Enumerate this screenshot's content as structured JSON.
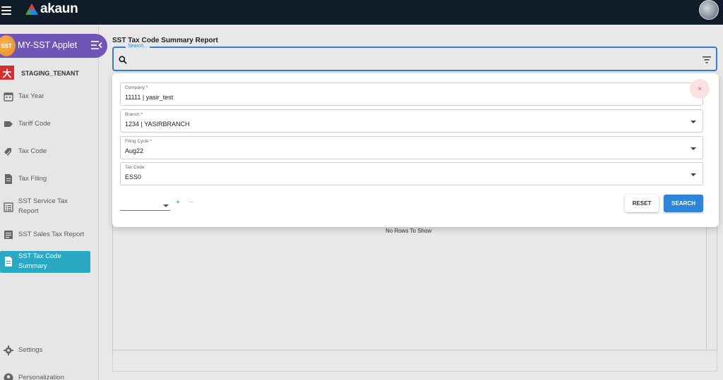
{
  "topbar": {
    "brand": "akaun",
    "brand_colors": [
      "#e53935",
      "#1e88e5",
      "#43a047"
    ]
  },
  "applet": {
    "badge": "SST",
    "title": "MY-SST Applet",
    "tenant_icon": "大",
    "tenant": "STAGING_TENANT"
  },
  "sidebar": {
    "items": [
      {
        "label": "Tax Year",
        "icon": "calendar-icon"
      },
      {
        "label": "Tariff Code",
        "icon": "tag-icon"
      },
      {
        "label": "Tax Code",
        "icon": "tags-icon"
      },
      {
        "label": "Tax Filing",
        "icon": "document-icon"
      },
      {
        "label": "SST Service Tax Report",
        "icon": "list-icon"
      },
      {
        "label": "SST Sales Tax Report",
        "icon": "report-icon"
      },
      {
        "label": "SST Tax Code Summary",
        "icon": "document-icon",
        "active": true
      },
      {
        "label": "Settings",
        "icon": "gear-icon"
      },
      {
        "label": "Personalization",
        "icon": "person-icon"
      }
    ]
  },
  "main": {
    "title": "SST Tax Code Summary Report",
    "search_legend": "Search...",
    "no_rows": "No Rows To Show"
  },
  "filters": {
    "company": {
      "label": "Company *",
      "value": "11111 | yasir_test"
    },
    "branch": {
      "label": "Branch *",
      "value": "1234 | YASIRBRANCH"
    },
    "filing_cycle": {
      "label": "Filing Cycle *",
      "value": "Aug22"
    },
    "tax_code": {
      "label": "Tax Code",
      "value": "ESS0"
    },
    "close": "×",
    "plus": "+",
    "minus": "−",
    "reset_label": "RESET",
    "search_label": "SEARCH"
  },
  "colors": {
    "accent": "#2f86d9",
    "applet": "#6f55b5",
    "active_nav": "#2ba8c4",
    "topbar": "#101c29"
  }
}
